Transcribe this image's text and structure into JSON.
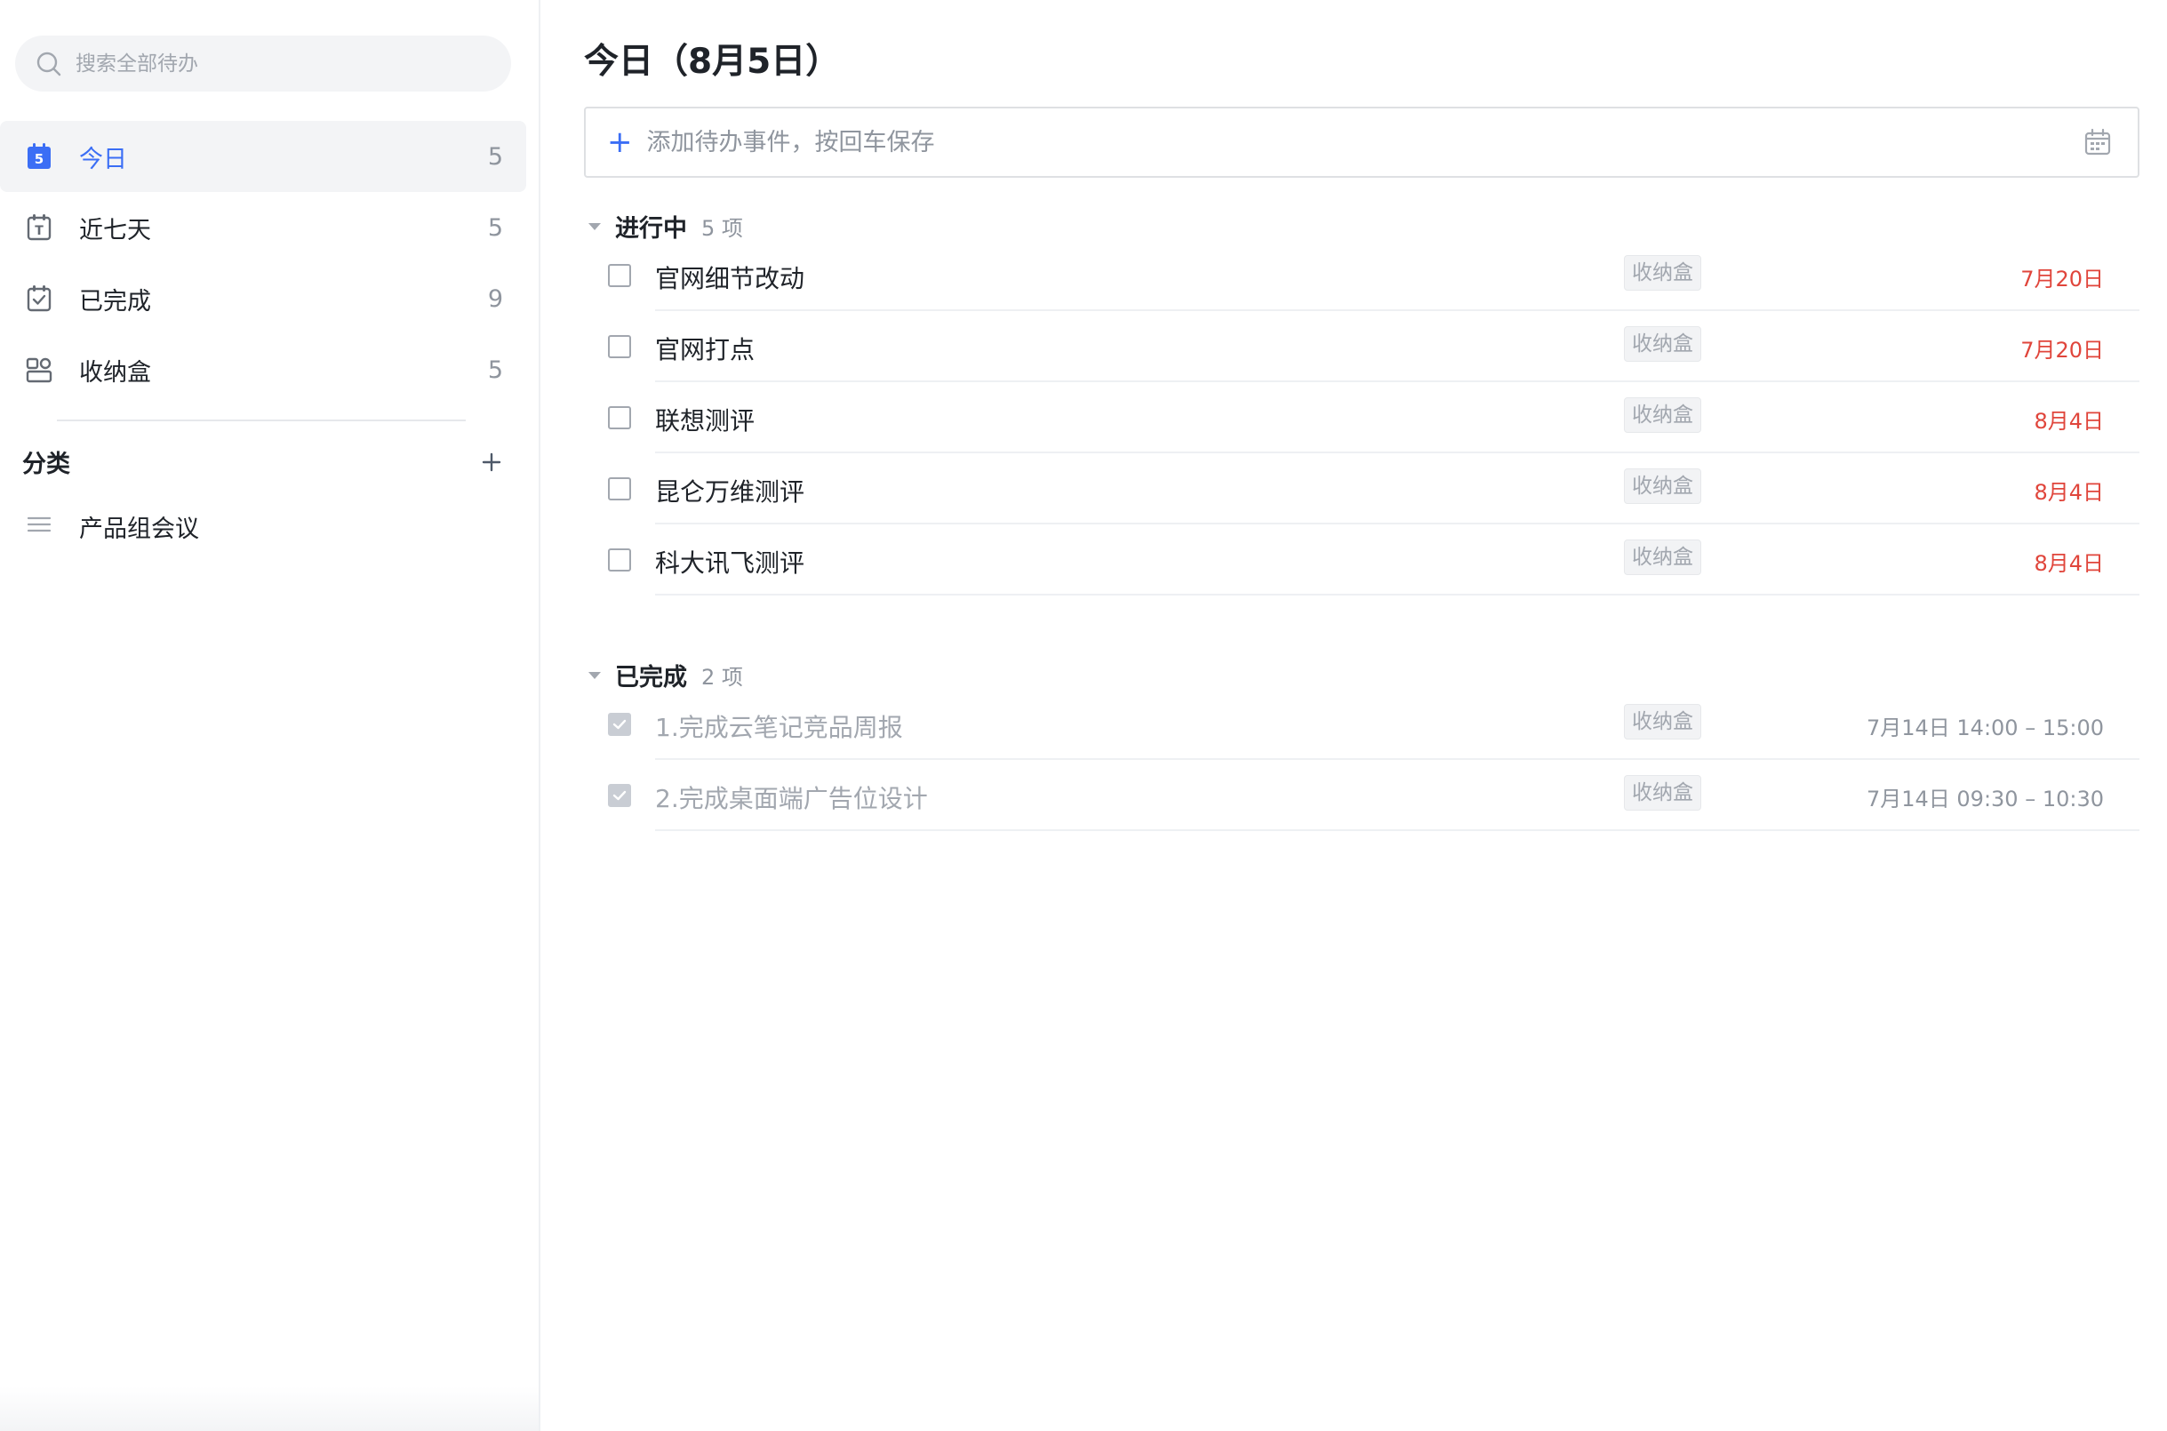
{
  "search": {
    "placeholder": "搜索全部待办"
  },
  "nav": [
    {
      "label": "今日",
      "count": "5",
      "icon": "calendar-today-icon",
      "icon_text": "5",
      "active": true
    },
    {
      "label": "近七天",
      "count": "5",
      "icon": "calendar-week-icon",
      "icon_text": "T",
      "active": false
    },
    {
      "label": "已完成",
      "count": "9",
      "icon": "calendar-check-icon",
      "active": false
    },
    {
      "label": "收纳盒",
      "count": "5",
      "icon": "inbox-icon",
      "active": false
    }
  ],
  "categories": {
    "title": "分类",
    "items": [
      {
        "label": "产品组会议",
        "icon": "list-icon"
      }
    ]
  },
  "main": {
    "title": "今日（8月5日）",
    "add_placeholder": "添加待办事件，按回车保存",
    "add_plus": "+",
    "in_progress": {
      "title": "进行中",
      "count": "5 项",
      "items": [
        {
          "text": "官网细节改动",
          "tag": "收纳盒",
          "date": "7月20日"
        },
        {
          "text": "官网打点",
          "tag": "收纳盒",
          "date": "7月20日"
        },
        {
          "text": "联想测评",
          "tag": "收纳盒",
          "date": "8月4日"
        },
        {
          "text": "昆仑万维测评",
          "tag": "收纳盒",
          "date": "8月4日"
        },
        {
          "text": "科大讯飞测评",
          "tag": "收纳盒",
          "date": "8月4日"
        }
      ]
    },
    "completed": {
      "title": "已完成",
      "count": "2 项",
      "items": [
        {
          "text": "1.完成云笔记竞品周报",
          "tag": "收纳盒",
          "date": "7月14日 14:00 – 15:00"
        },
        {
          "text": "2.完成桌面端广告位设计",
          "tag": "收纳盒",
          "date": "7月14日 09:30 – 10:30"
        }
      ]
    }
  },
  "colors": {
    "accent": "#3b6ef5",
    "overdue": "#e0453b",
    "muted": "#8f959e"
  }
}
